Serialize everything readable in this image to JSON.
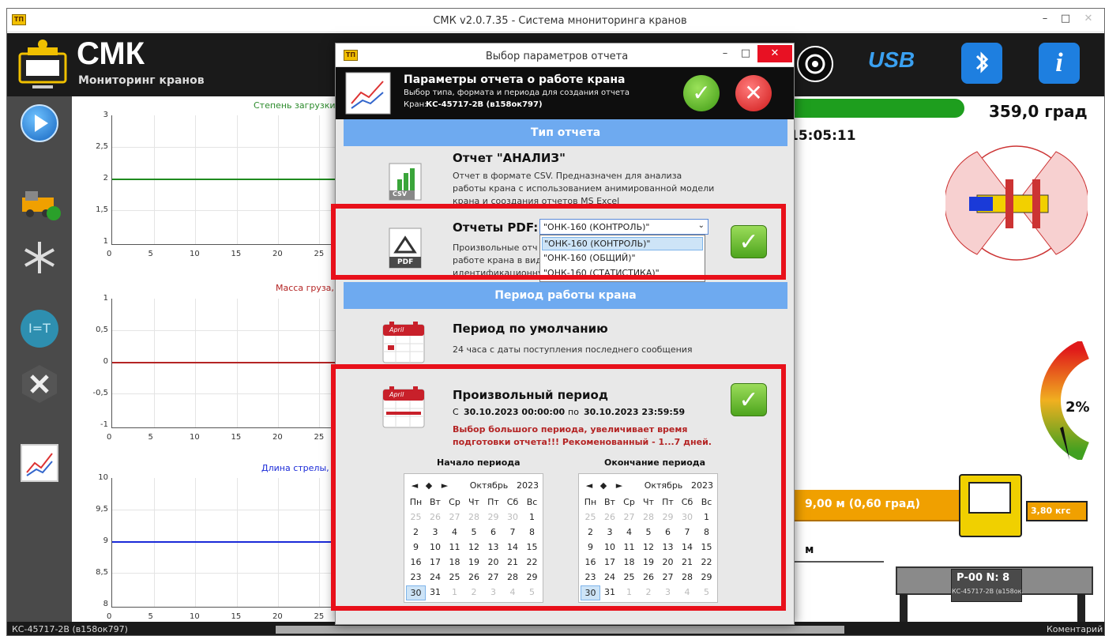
{
  "window": {
    "title": "СМК v2.0.7.35 - Система мнониторинга кранов",
    "min": "–",
    "max": "□",
    "close": "✕"
  },
  "brand": {
    "logo_text": "СМК",
    "subtitle": "Мониторинг кранов"
  },
  "toolbar": {
    "usb_label": "USB",
    "info_label": "i",
    "bluetooth": "bluetooth-icon",
    "target": "target-icon"
  },
  "charts": [
    {
      "title": "Степень загрузки",
      "y_ticks": [
        "3",
        "2,5",
        "2",
        "1,5",
        "1"
      ],
      "x_ticks": [
        "0",
        "5",
        "10",
        "15",
        "20",
        "25"
      ]
    },
    {
      "title": "Масса груза, С",
      "y_ticks": [
        "1",
        "0,5",
        "0",
        "-0,5",
        "-1"
      ],
      "x_ticks": [
        "0",
        "5",
        "10",
        "15",
        "20",
        "25"
      ]
    },
    {
      "title": "Длина стрелы,",
      "y_ticks": [
        "10",
        "9,5",
        "9",
        "8,5",
        "8"
      ],
      "x_ticks": [
        "0",
        "5",
        "10",
        "15",
        "20",
        "25"
      ]
    }
  ],
  "chart_data": [
    {
      "type": "line",
      "title": "Степень загрузки",
      "ylim": [
        1,
        3
      ],
      "x": [
        0,
        25
      ],
      "series": [
        {
          "values": [
            2,
            2
          ]
        }
      ]
    },
    {
      "type": "line",
      "title": "Масса груза, С",
      "ylim": [
        -1,
        1
      ],
      "x": [
        0,
        25
      ],
      "series": [
        {
          "values": [
            0,
            0
          ]
        }
      ]
    },
    {
      "type": "line",
      "title": "Длина стрелы,",
      "ylim": [
        8,
        10
      ],
      "x": [
        0,
        25
      ],
      "series": [
        {
          "values": [
            9,
            9
          ]
        }
      ]
    }
  ],
  "right_panel": {
    "angle": "359,0 град",
    "time": "15:05:11",
    "gauge_percent": "2%",
    "boom": "9,00 м (0,60 град)",
    "load": "3,80 кгс",
    "unit_m": "м",
    "plate": "Р-00  N: 8",
    "plate_sub": "КС-45717-2В (в158ок..."
  },
  "colors": {
    "accent": "#6eaaf0",
    "red_frame": "#e8101a",
    "progress_green": "#1e9e1e"
  },
  "dialog": {
    "title": "Выбор параметров отчета",
    "min": "–",
    "max": "□",
    "close": "✕",
    "header_title": "Параметры отчета о работе крана",
    "header_sub": "Выбор типа, формата и периода для создания отчета",
    "header_crane_label": "Кран:",
    "header_crane": "КС-45717-2В (в158ок797)",
    "type_section": "Тип отчета",
    "analysis_title": "Отчет \"АНАЛИЗ\"",
    "analysis_desc_1": "Отчет в формате CSV. Предназначен для анализа",
    "analysis_desc_2": "работы крана с использованием анимированной модели",
    "analysis_desc_3": "крана и сооздания отчетов MS Excel",
    "csv_label": "CSV",
    "pdf_title": "Отчеты PDF:",
    "pdf_selected": "\"ОНК-160 (КОНТРОЛЬ)\"",
    "pdf_options": [
      "\"ОНК-160 (КОНТРОЛЬ)\"",
      "\"ОНК-160 (ОБЩИЙ)\"",
      "\"ОНК-160 (СТАТИСТИКА)\""
    ],
    "pdf_desc_1": "Произвольные отч",
    "pdf_desc_2": "работе крана в вид",
    "pdf_desc_3": "идентификационну",
    "pdf_label": "PDF",
    "period_section": "Период работы крана",
    "default_title": "Период по умолчанию",
    "default_desc": "24 часа с даты поступления последнего сообщения",
    "april": "April",
    "custom_title": "Произвольный период",
    "from_label": "С",
    "from_value": "30.10.2023 00:00:00",
    "to_label": "по",
    "to_value": "30.10.2023 23:59:59",
    "warning_1": "Выбор большого периода, увеличивает время",
    "warning_2": "подготовки отчета!!! Рекоменованный - 1...7 дней.",
    "start_label": "Начало периода",
    "end_label": "Окончание периода"
  },
  "calendar": {
    "nav": [
      "◄",
      "◆",
      "►"
    ],
    "month": "Октябрь",
    "year": "2023",
    "weekdays": [
      "Пн",
      "Вт",
      "Ср",
      "Чт",
      "Пт",
      "Сб",
      "Вс"
    ],
    "weeks": [
      [
        "25",
        "26",
        "27",
        "28",
        "29",
        "30",
        "1"
      ],
      [
        "2",
        "3",
        "4",
        "5",
        "6",
        "7",
        "8"
      ],
      [
        "9",
        "10",
        "11",
        "12",
        "13",
        "14",
        "15"
      ],
      [
        "16",
        "17",
        "18",
        "19",
        "20",
        "21",
        "22"
      ],
      [
        "23",
        "24",
        "25",
        "26",
        "27",
        "28",
        "29"
      ],
      [
        "30",
        "31",
        "1",
        "2",
        "3",
        "4",
        "5"
      ]
    ],
    "selected": "30"
  },
  "status": {
    "crane": "КС-45717-2В (в158ок797)",
    "comment": "Коментарий"
  }
}
